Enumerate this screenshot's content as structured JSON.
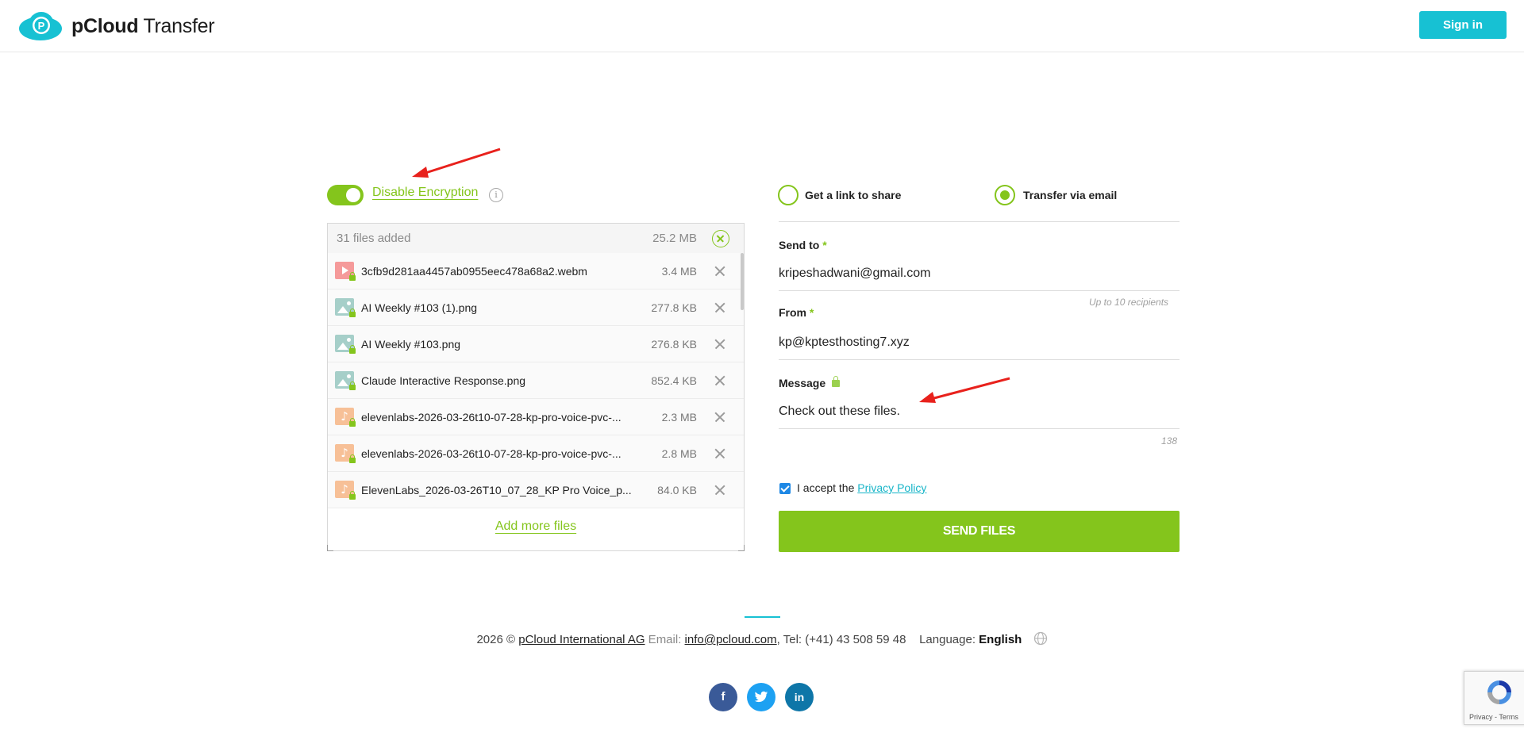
{
  "header": {
    "logo_bold": "pCloud",
    "logo_rest": " Transfer",
    "signin_label": "Sign in"
  },
  "encryption": {
    "label": "Disable Encryption",
    "enabled": true,
    "info_icon": "info-icon"
  },
  "files": {
    "count_text": "31 files added",
    "total_size": "25.2 MB",
    "items": [
      {
        "name": "3cfb9d281aa4457ab0955eec478a68a2.webm",
        "size": "3.4 MB",
        "type": "video"
      },
      {
        "name": "AI Weekly #103 (1).png",
        "size": "277.8 KB",
        "type": "image"
      },
      {
        "name": "AI Weekly #103.png",
        "size": "276.8 KB",
        "type": "image"
      },
      {
        "name": "Claude Interactive Response.png",
        "size": "852.4 KB",
        "type": "image"
      },
      {
        "name": "elevenlabs-2026-03-26t10-07-28-kp-pro-voice-pvc-...",
        "size": "2.3 MB",
        "type": "audio"
      },
      {
        "name": "elevenlabs-2026-03-26t10-07-28-kp-pro-voice-pvc-...",
        "size": "2.8 MB",
        "type": "audio"
      },
      {
        "name": "ElevenLabs_2026-03-26T10_07_28_KP Pro Voice_p...",
        "size": "84.0 KB",
        "type": "audio"
      }
    ],
    "add_more_label": "Add more files"
  },
  "transfer_mode": {
    "option_link": "Get a link to share",
    "option_email": "Transfer via email",
    "selected": "email"
  },
  "form": {
    "send_to_label": "Send to",
    "send_to_value": "kripeshadwani@gmail.com",
    "send_to_hint": "Up to 10 recipients",
    "from_label": "From",
    "from_value": "kp@kptesthosting7.xyz",
    "message_label": "Message",
    "message_value": "Check out these files.",
    "message_counter": "138",
    "required_mark": "*",
    "accept_text": "I accept the ",
    "privacy_link": "Privacy Policy",
    "send_button": "SEND FILES"
  },
  "footer": {
    "year_copy": "2026 © ",
    "company": "pCloud International AG",
    "email_label": " Email: ",
    "email": "info@pcloud.com",
    "tel": ", Tel: (+41) 43 508 59 48",
    "language_label": "Language: ",
    "language": "English",
    "social": [
      "f",
      "t",
      "in"
    ]
  },
  "recaptcha": {
    "links": "Privacy - Terms"
  },
  "colors": {
    "accent_green": "#84c51c",
    "brand_cyan": "#17c1d3",
    "annotation_red": "#e8211c"
  }
}
